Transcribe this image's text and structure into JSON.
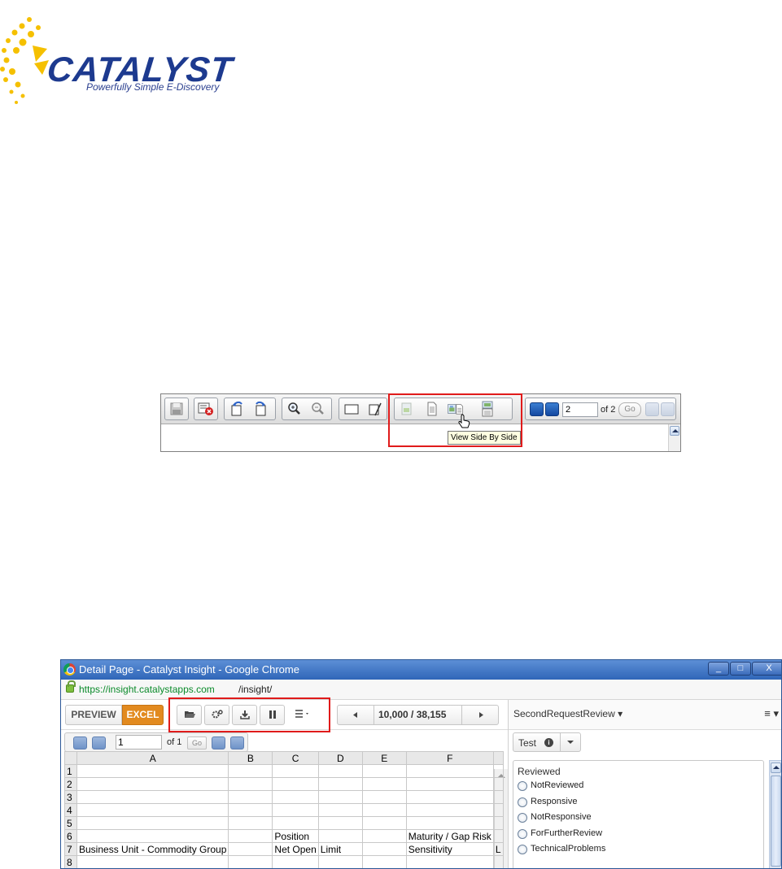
{
  "logo": {
    "word": "CATALYST",
    "tagline": "Powerfully Simple E-Discovery",
    "colors": {
      "sunburst": "#f5c000",
      "text": "#1d3a8f"
    }
  },
  "viewer_toolbar": {
    "buttons": [
      {
        "name": "save-icon"
      },
      {
        "name": "close-document-icon"
      },
      {
        "name": "rotate-left-icon"
      },
      {
        "name": "rotate-right-icon"
      },
      {
        "name": "zoom-in-icon"
      },
      {
        "name": "zoom-out-icon"
      },
      {
        "name": "fit-width-icon"
      },
      {
        "name": "annotate-icon"
      },
      {
        "name": "view-image-icon"
      },
      {
        "name": "view-text-icon"
      },
      {
        "name": "view-side-by-side-icon"
      },
      {
        "name": "view-stacked-icon"
      }
    ],
    "page_value": "2",
    "of_text": "of 2",
    "go_label": "Go",
    "tooltip": "View Side By Side",
    "highlight_color": "#e01b1b"
  },
  "browser": {
    "title": "Detail Page - Catalyst Insight - Google Chrome",
    "controls": {
      "minimize": "_",
      "maximize": "□",
      "close": "X"
    },
    "url_secure": "https://insight.catalystapps.com",
    "url_path": "/insight/"
  },
  "app": {
    "modes": {
      "preview": "PREVIEW",
      "excel": "EXCEL",
      "active": "EXCEL",
      "accent": "#e28a1f"
    },
    "toolbar_icons": [
      "folder-open-icon",
      "settings-icon",
      "download-icon",
      "pause-icon",
      "list-menu-icon"
    ],
    "doc_position": "10,000  /  38,155",
    "sheet_pager": {
      "page_value": "1",
      "of_text": "of 1",
      "go_label": "Go"
    },
    "sheet": {
      "columns": [
        "",
        "A",
        "B",
        "C",
        "D",
        "E",
        "F",
        ""
      ],
      "rows": [
        [
          "1",
          "",
          "",
          "",
          "",
          "",
          "",
          ""
        ],
        [
          "2",
          "",
          "",
          "",
          "",
          "",
          "",
          ""
        ],
        [
          "3",
          "",
          "",
          "",
          "",
          "",
          "",
          ""
        ],
        [
          "4",
          "",
          "",
          "",
          "",
          "",
          "",
          ""
        ],
        [
          "5",
          "",
          "",
          "",
          "",
          "",
          "",
          ""
        ],
        [
          "6",
          "",
          "",
          "Position",
          "",
          "",
          "Maturity / Gap Risk",
          ""
        ],
        [
          "7",
          "Business Unit - Commodity Group",
          "",
          "Net Open",
          "Limit",
          "",
          "Sensitivity",
          "L"
        ],
        [
          "8",
          "",
          "",
          "",
          "",
          "",
          "",
          ""
        ]
      ]
    },
    "review_panel": {
      "title": "SecondRequestReview",
      "menu_icon": "≡",
      "tag_button": "Test",
      "group_title": "Reviewed",
      "options": [
        "NotReviewed",
        "Responsive",
        "NotResponsive",
        "ForFurtherReview",
        "TechnicalProblems"
      ]
    }
  }
}
